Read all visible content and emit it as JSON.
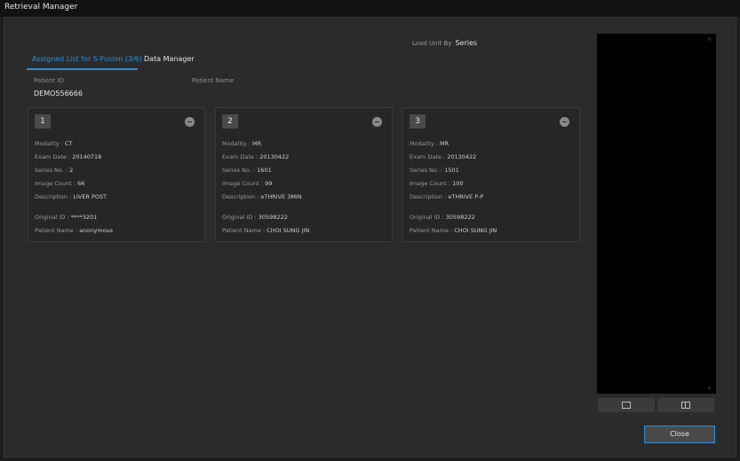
{
  "window": {
    "title": "Retrieval Manager"
  },
  "load_unit": {
    "label": "Load Unit By",
    "value": "Series"
  },
  "tabs": [
    {
      "label": "Assigned List for S-Fusion (3/6)",
      "active": true
    },
    {
      "label": "Data Manager",
      "active": false
    }
  ],
  "patient": {
    "id_label": "Patient ID",
    "id_value": "DEMO556666",
    "name_label": "Patient Name"
  },
  "cards": [
    {
      "number": "1",
      "modality_label": "Modality : ",
      "modality": "CT",
      "exam_date_label": "Exam Date : ",
      "exam_date": "20140718",
      "series_no_label": "Series No. : ",
      "series_no": "2",
      "image_count_label": "Image Count : ",
      "image_count": "66",
      "description_label": "Description : ",
      "description": "LIVER POST",
      "original_id_label": "Original ID : ",
      "original_id": "****3201",
      "patient_name_label": "Patient Name : ",
      "patient_name": "anonymous"
    },
    {
      "number": "2",
      "modality_label": "Modality : ",
      "modality": "MR",
      "exam_date_label": "Exam Date : ",
      "exam_date": "20130422",
      "series_no_label": "Series No. : ",
      "series_no": "1601",
      "image_count_label": "Image Count : ",
      "image_count": "99",
      "description_label": "Description : ",
      "description": "eTHRIVE 3MIN",
      "original_id_label": "Original ID : ",
      "original_id": "30598222",
      "patient_name_label": "Patient Name : ",
      "patient_name": "CHOI SUNG JIN"
    },
    {
      "number": "3",
      "modality_label": "Modality : ",
      "modality": "MR",
      "exam_date_label": "Exam Date : ",
      "exam_date": "20130422",
      "series_no_label": "Series No. : ",
      "series_no": "1501",
      "image_count_label": "Image Count : ",
      "image_count": "100",
      "description_label": "Description : ",
      "description": "eTHRIVE P-P",
      "original_id_label": "Original ID : ",
      "original_id": "30598222",
      "patient_name_label": "Patient Name : ",
      "patient_name": "CHOI SUNG JIN"
    }
  ],
  "buttons": {
    "close": "Close"
  },
  "icons": {
    "remove": "minus-circle-icon",
    "single_layout": "single-panel-icon",
    "split_layout": "split-panel-icon"
  },
  "colors": {
    "accent": "#2f8fd6",
    "background": "#2b2b2b",
    "preview": "#000000"
  }
}
